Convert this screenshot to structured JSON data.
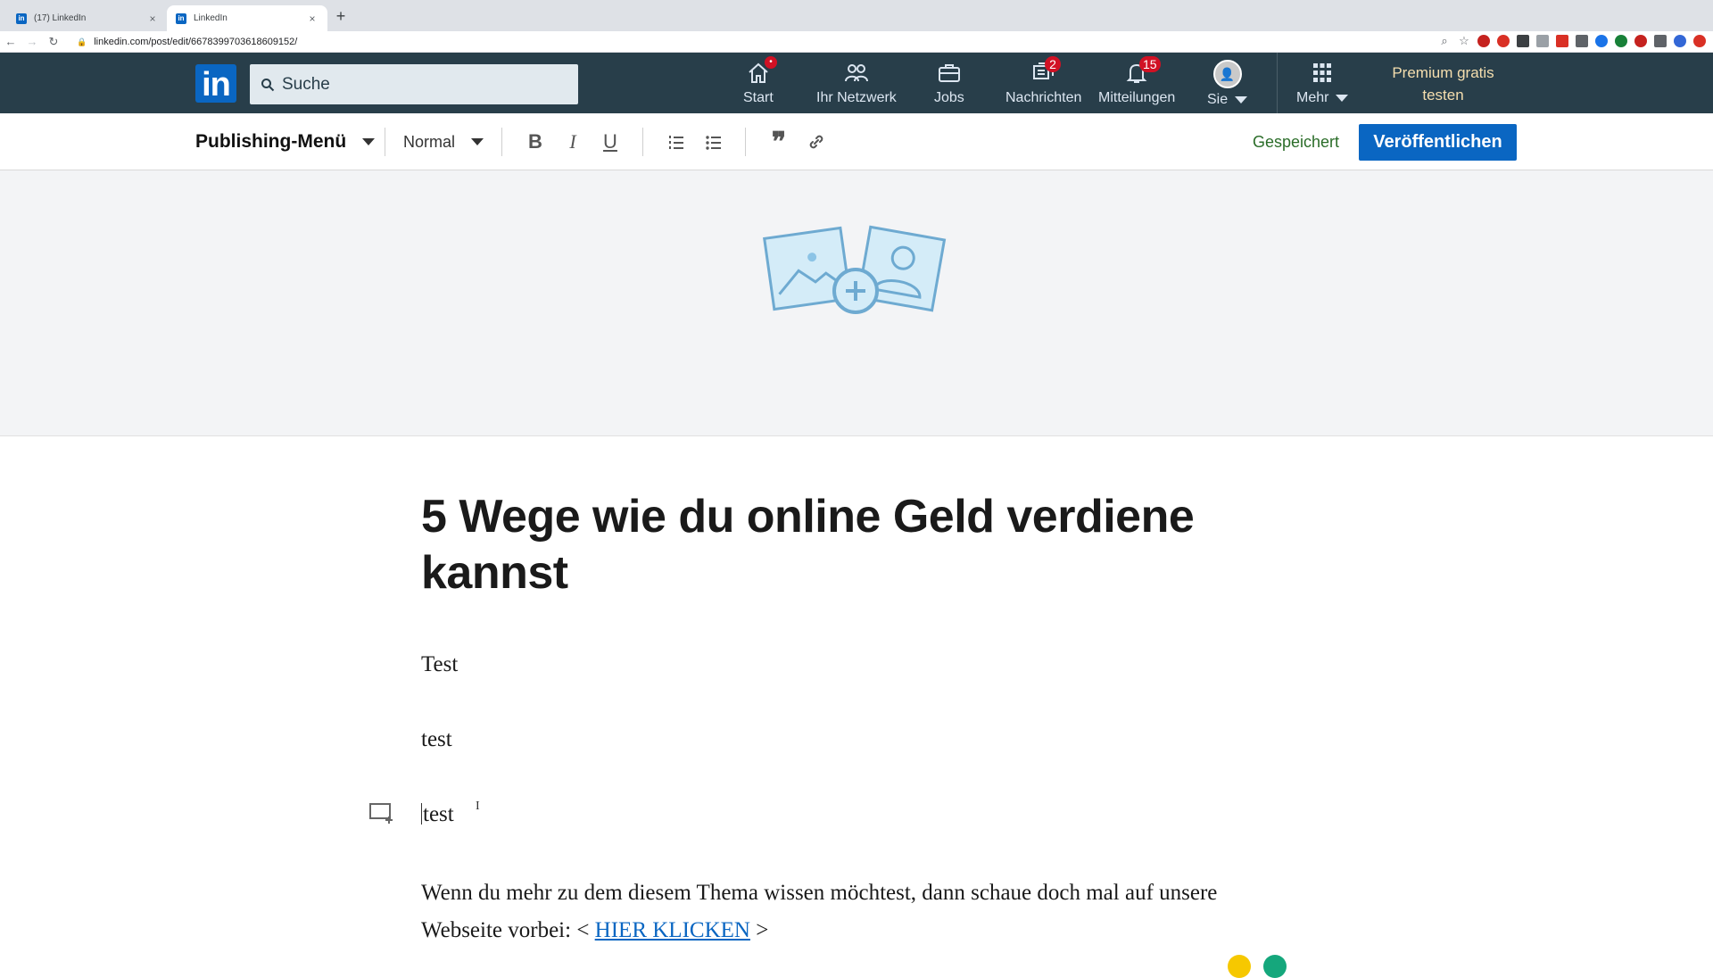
{
  "browser": {
    "tabs": [
      {
        "title": "(17) LinkedIn",
        "active": false
      },
      {
        "title": "LinkedIn",
        "active": true
      }
    ],
    "new_tab_symbol": "+",
    "close_symbol": "×",
    "url": "linkedin.com/post/edit/6678399703618609152/"
  },
  "nav": {
    "logo_text": "in",
    "search_placeholder": "Suche",
    "items": [
      {
        "label": "Start",
        "icon": "home-icon",
        "badge": ""
      },
      {
        "label": "Ihr Netzwerk",
        "icon": "network-icon",
        "badge": ""
      },
      {
        "label": "Jobs",
        "icon": "briefcase-icon",
        "badge": ""
      },
      {
        "label": "Nachrichten",
        "icon": "messages-icon",
        "badge": "2"
      },
      {
        "label": "Mitteilungen",
        "icon": "bell-icon",
        "badge": "15"
      },
      {
        "label": "Sie",
        "icon": "avatar",
        "badge": ""
      },
      {
        "label": "Mehr",
        "icon": "grid-icon",
        "badge": ""
      }
    ],
    "premium_line1": "Premium gratis",
    "premium_line2": "testen"
  },
  "editor_toolbar": {
    "publishing_menu": "Publishing-Menü",
    "style_select": "Normal",
    "saved_status": "Gespeichert",
    "publish_button": "Veröffentlichen"
  },
  "article": {
    "title": "5 Wege wie du online Geld verdiene kannst",
    "paragraphs": [
      "Test",
      "test",
      "test"
    ],
    "closing_text": "Wenn du mehr zu dem diesem Thema wissen möchtest, dann schaue doch mal auf unsere Webseite vorbei: < ",
    "link_text": "HIER KLICKEN",
    "closing_suffix": " >"
  },
  "colors": {
    "linkedin_blue": "#0a66c2",
    "nav_bg": "#283e4a",
    "premium_gold": "#f5deae",
    "saved_green": "#2b6d29",
    "badge_red": "#d11124"
  }
}
